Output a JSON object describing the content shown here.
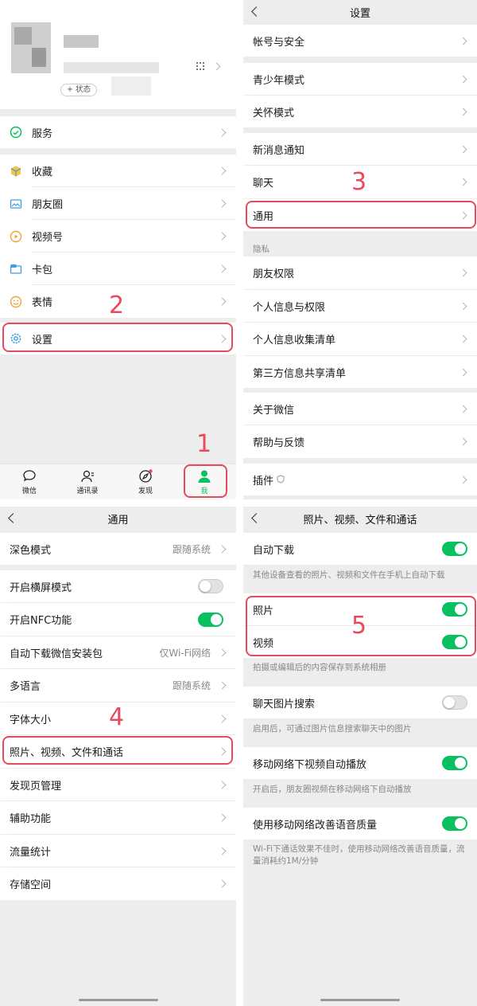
{
  "panel1": {
    "status_label": "+ 状态",
    "menu": [
      {
        "label": "服务",
        "icon": "service-icon"
      },
      {
        "label": "收藏",
        "icon": "favorites-cube-icon"
      },
      {
        "label": "朋友圈",
        "icon": "moments-image-icon"
      },
      {
        "label": "视频号",
        "icon": "channels-play-icon"
      },
      {
        "label": "卡包",
        "icon": "card-wallet-icon"
      },
      {
        "label": "表情",
        "icon": "sticker-smile-icon"
      },
      {
        "label": "设置",
        "icon": "settings-gear-icon"
      }
    ],
    "tabs": [
      {
        "label": "微信"
      },
      {
        "label": "通讯录"
      },
      {
        "label": "发现"
      },
      {
        "label": "我"
      }
    ],
    "steps": {
      "s1": "1",
      "s2": "2"
    }
  },
  "panel2": {
    "title": "设置",
    "items": [
      "帐号与安全",
      "青少年模式",
      "关怀模式",
      "新消息通知",
      "聊天",
      "通用",
      "朋友权限",
      "个人信息与权限",
      "个人信息收集清单",
      "第三方信息共享清单",
      "关于微信",
      "帮助与反馈",
      "插件"
    ],
    "privacy_label": "隐私",
    "step": "3"
  },
  "panel3": {
    "title": "通用",
    "items": [
      {
        "label": "深色模式",
        "value": "跟随系统"
      },
      {
        "label": "开启横屏模式",
        "toggle": "off"
      },
      {
        "label": "开启NFC功能",
        "toggle": "on"
      },
      {
        "label": "自动下载微信安装包",
        "value": "仅Wi-Fi网络"
      },
      {
        "label": "多语言",
        "value": "跟随系统"
      },
      {
        "label": "字体大小"
      },
      {
        "label": "照片、视频、文件和通话"
      },
      {
        "label": "发现页管理"
      },
      {
        "label": "辅助功能"
      },
      {
        "label": "流量统计"
      },
      {
        "label": "存储空间"
      }
    ],
    "step": "4"
  },
  "panel4": {
    "title": "照片、视频、文件和通话",
    "auto_download": "自动下载",
    "auto_download_desc": "其他设备查看的照片、视频和文件在手机上自动下载",
    "photo": "照片",
    "video": "视频",
    "save_desc": "拍摄或编辑后的内容保存到系统相册",
    "chat_image_search": "聊天图片搜索",
    "chat_image_desc": "启用后，可通过图片信息搜索聊天中的图片",
    "autoplay": "移动网络下视频自动播放",
    "autoplay_desc": "开启后，朋友圈视频在移动网络下自动播放",
    "voice_quality": "使用移动网络改善语音质量",
    "voice_desc": "Wi-Fi下通话效果不佳时，使用移动网络改善语音质量，流量消耗约1M/分钟",
    "step": "5"
  },
  "colors": {
    "accent": "#07c160",
    "highlight": "#e84a5b"
  }
}
